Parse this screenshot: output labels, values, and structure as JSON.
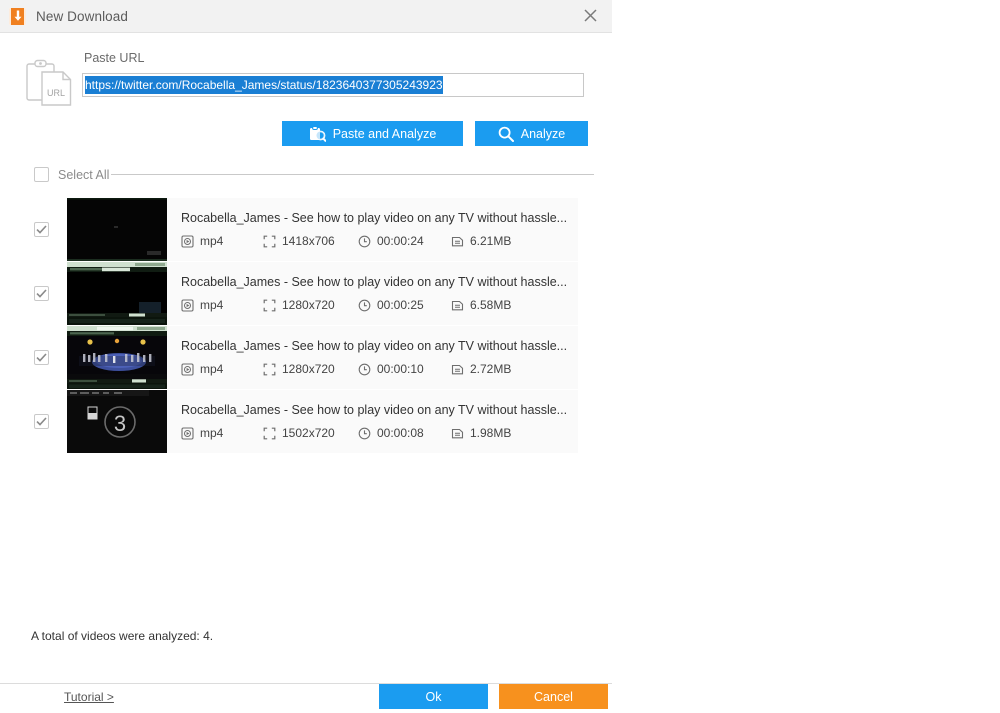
{
  "window": {
    "title": "New Download",
    "app_icon": "download-arrow-icon",
    "close_icon": "close-icon"
  },
  "url_section": {
    "icon": "clipboard-url-icon",
    "label": "Paste URL",
    "value": "https://twitter.com/Rocabella_James/status/1823640377305243923",
    "placeholder": "Paste URL",
    "selected": true,
    "selection_color": "#1a7fd4"
  },
  "actions": {
    "paste_and_analyze": "Paste and Analyze",
    "paste_icon": "clipboard-search-icon",
    "analyze": "Analyze",
    "analyze_icon": "search-icon",
    "accent_color": "#1b9cf0"
  },
  "select_all": {
    "label": "Select All",
    "checked": false
  },
  "columns": {
    "format": "format-icon",
    "resolution": "resolution-icon",
    "duration": "clock-icon",
    "size": "file-icon"
  },
  "videos": [
    {
      "checked": true,
      "title": "Rocabella_James - See how to play video on any TV without hassle...",
      "format": "mp4",
      "resolution": "1418x706",
      "duration": "00:00:24",
      "size": "6.21MB",
      "thumb": "dark-video-frame"
    },
    {
      "checked": true,
      "title": "Rocabella_James - See how to play video on any TV without hassle...",
      "format": "mp4",
      "resolution": "1280x720",
      "duration": "00:00:25",
      "size": "6.58MB",
      "thumb": "player-window-dark"
    },
    {
      "checked": true,
      "title": "Rocabella_James - See how to play video on any TV without hassle...",
      "format": "mp4",
      "resolution": "1280x720",
      "duration": "00:00:10",
      "size": "2.72MB",
      "thumb": "concert-stage-frame"
    },
    {
      "checked": true,
      "title": "Rocabella_James - See how to play video on any TV without hassle...",
      "format": "mp4",
      "resolution": "1502x720",
      "duration": "00:00:08",
      "size": "1.98MB",
      "thumb": "countdown-three-frame"
    }
  ],
  "status": {
    "text": "A total of videos were analyzed: 4."
  },
  "footer": {
    "tutorial": "Tutorial >",
    "ok": "Ok",
    "cancel": "Cancel",
    "ok_color": "#1b9cf0",
    "cancel_color": "#f7911e"
  }
}
